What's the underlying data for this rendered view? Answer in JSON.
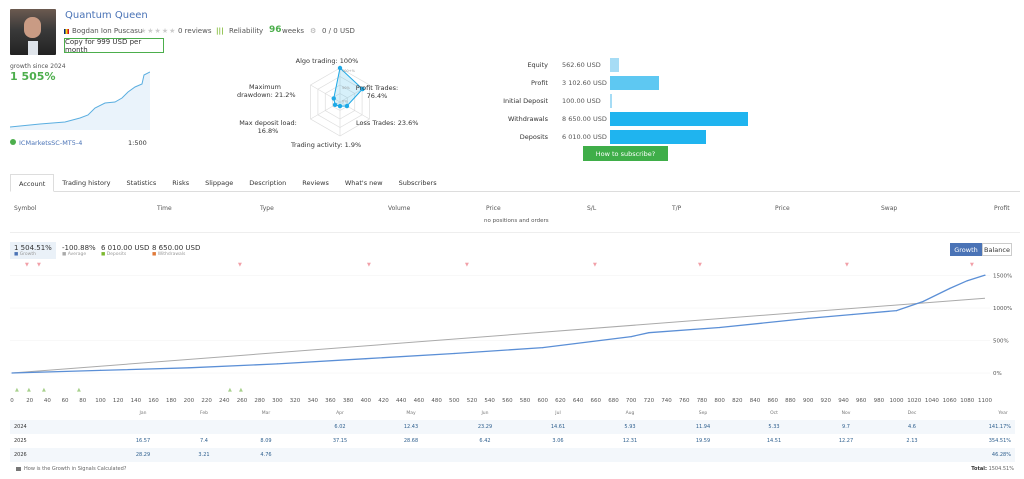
{
  "header": {
    "title": "Quantum Queen",
    "author": "Bogdan Ion Puscasu",
    "reviews": "0 reviews",
    "reliability_label": "Reliability",
    "weeks_value": "96",
    "weeks_label": "weeks",
    "subscribers_funds": "0 / 0 USD",
    "copy_button": "Copy for 999 USD per month",
    "rating_stars": 0
  },
  "mini": {
    "growth_label": "growth since 2024",
    "growth_value": "1 505%",
    "broker": "ICMarketsSC-MT5-4",
    "leverage": "1:500"
  },
  "radar": {
    "algo": "Algo trading: 100%",
    "profit": "Profit Trades:\n76.4%",
    "loss": "Loss Trades: 23.6%",
    "activity": "Trading activity: 1.9%",
    "load": "Max deposit load:\n16.8%",
    "drawdown": "Maximum\ndrawdown: 21.2%",
    "ring_100": "100+%",
    "ring_50": "50%",
    "ring_0": "0%",
    "values": {
      "algo": 100,
      "profit": 76.4,
      "loss": 23.6,
      "activity": 1.9,
      "load": 16.8,
      "drawdown": 21.2
    }
  },
  "finance": [
    {
      "label": "Equity",
      "value": "562.60 USD",
      "amount": 562.6,
      "color": "#a6dcf5"
    },
    {
      "label": "Profit",
      "value": "3 102.60 USD",
      "amount": 3102.6,
      "color": "#5ec8f2"
    },
    {
      "label": "Initial Deposit",
      "value": "100.00 USD",
      "amount": 100,
      "color": "#a6dcf5"
    },
    {
      "label": "Withdrawals",
      "value": "8 650.00 USD",
      "amount": 8650,
      "color": "#1fb4ef"
    },
    {
      "label": "Deposits",
      "value": "6 010.00 USD",
      "amount": 6010,
      "color": "#1fb4ef"
    }
  ],
  "subscribe_button": "How to subscribe?",
  "tabs": [
    "Account",
    "Trading history",
    "Statistics",
    "Risks",
    "Slippage",
    "Description",
    "Reviews",
    "What's new",
    "Subscribers"
  ],
  "positions": {
    "columns": [
      "Symbol",
      "Time",
      "Type",
      "Volume",
      "Price",
      "S/L",
      "T/P",
      "Price",
      "Swap",
      "Profit"
    ],
    "empty": "no positions and orders"
  },
  "stats": [
    {
      "value": "1 504.51%",
      "label": "Growth"
    },
    {
      "value": "-100.88%",
      "label": "Average"
    },
    {
      "value": "6 010.00 USD",
      "label": "Deposits"
    },
    {
      "value": "8 650.00 USD",
      "label": "Withdrawals"
    }
  ],
  "chart_toggle": {
    "growth": "Growth",
    "balance": "Balance"
  },
  "chart_data": {
    "type": "line",
    "x_ticks": [
      0,
      20,
      40,
      60,
      80,
      100,
      120,
      140,
      160,
      180,
      200,
      220,
      240,
      260,
      280,
      300,
      320,
      340,
      360,
      380,
      400,
      420,
      440,
      460,
      480,
      500,
      520,
      540,
      560,
      580,
      600,
      620,
      640,
      660,
      680,
      700,
      720,
      740,
      760,
      780,
      800,
      820,
      840,
      860,
      880,
      900,
      920,
      940,
      960,
      980,
      1000,
      1020,
      1040,
      1060,
      1080,
      1100
    ],
    "y_ticks": [
      "0%",
      "500%",
      "1000%",
      "1500%"
    ],
    "ylim": [
      -50,
      1600
    ],
    "xlim": [
      0,
      1100
    ],
    "series": [
      {
        "x": [
          0,
          100,
          200,
          300,
          400,
          500,
          600,
          700,
          720,
          800,
          900,
          950,
          1000,
          1030,
          1060,
          1080,
          1100
        ],
        "y": [
          0,
          40,
          80,
          140,
          220,
          300,
          390,
          560,
          620,
          700,
          840,
          900,
          960,
          1100,
          1300,
          1420,
          1505
        ]
      },
      {
        "x": [
          0,
          1100
        ],
        "y": [
          0,
          1150
        ]
      }
    ]
  },
  "monthly": {
    "months": [
      "Jan",
      "Feb",
      "Mar",
      "Apr",
      "May",
      "Jun",
      "Jul",
      "Aug",
      "Sep",
      "Oct",
      "Nov",
      "Dec",
      "Year"
    ],
    "rows": [
      {
        "year": "2024",
        "values": [
          "",
          "",
          "",
          "6.02",
          "12.43",
          "23.29",
          "14.61",
          "5.93",
          "11.94",
          "5.33",
          "9.7",
          "4.6"
        ],
        "total": "141.17%"
      },
      {
        "year": "2025",
        "values": [
          "16.57",
          "7.4",
          "8.09",
          "37.15",
          "28.68",
          "6.42",
          "3.06",
          "12.31",
          "19.59",
          "14.51",
          "12.27",
          "2.13"
        ],
        "total": "354.51%"
      },
      {
        "year": "2026",
        "values": [
          "28.29",
          "3.21",
          "4.76",
          "",
          "",
          "",
          "",
          "",
          "",
          "",
          "",
          ""
        ],
        "total": "46.28%"
      }
    ],
    "how_link": "How is the Growth in Signals Calculated?",
    "total_label": "Total:",
    "total_value": "1504.51%"
  }
}
